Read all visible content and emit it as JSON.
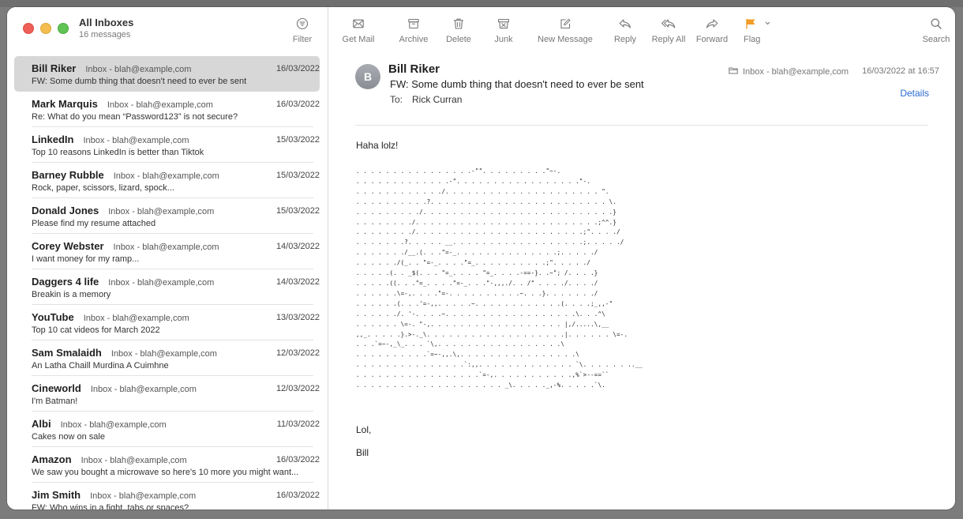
{
  "mailbox": {
    "title": "All Inboxes",
    "subtitle": "16 messages",
    "filter_label": "Filter"
  },
  "toolbar": {
    "get_mail": "Get Mail",
    "archive": "Archive",
    "delete": "Delete",
    "junk": "Junk",
    "new_message": "New Message",
    "reply": "Reply",
    "reply_all": "Reply All",
    "forward": "Forward",
    "flag": "Flag",
    "search": "Search"
  },
  "icons": {
    "get_mail": "envelope-icon",
    "archive": "archive-box-icon",
    "delete": "trash-icon",
    "junk": "junk-bin-icon",
    "new_message": "compose-icon",
    "reply": "reply-arrow-icon",
    "reply_all": "reply-all-arrow-icon",
    "forward": "forward-arrow-icon",
    "flag": "flag-icon",
    "search": "magnifier-icon"
  },
  "colors": {
    "flag": "#f39c28",
    "link": "#2a6cd1",
    "selected_row": "#d7d7d7",
    "traffic_red": "#ee5f57",
    "traffic_yellow": "#f4bd4f",
    "traffic_green": "#5fc454"
  },
  "messages": [
    {
      "sender": "Bill Riker",
      "mailbox": "Inbox - blah@example,com",
      "date": "16/03/2022",
      "subject": "FW: Some dumb thing that doesn't need to ever be sent"
    },
    {
      "sender": "Mark Marquis",
      "mailbox": "Inbox - blah@example,com",
      "date": "16/03/2022",
      "subject": "Re: What do you mean “Password123” is not secure?"
    },
    {
      "sender": "LinkedIn",
      "mailbox": "Inbox - blah@example,com",
      "date": "15/03/2022",
      "subject": "Top 10 reasons LinkedIn is better than Tiktok"
    },
    {
      "sender": "Barney Rubble",
      "mailbox": "Inbox - blah@example,com",
      "date": "15/03/2022",
      "subject": "Rock, paper, scissors, lizard, spock..."
    },
    {
      "sender": "Donald Jones",
      "mailbox": "Inbox - blah@example,com",
      "date": "15/03/2022",
      "subject": "Please find my resume attached"
    },
    {
      "sender": "Corey Webster",
      "mailbox": "Inbox - blah@example,com",
      "date": "14/03/2022",
      "subject": "I want money for my ramp..."
    },
    {
      "sender": "Daggers 4 life",
      "mailbox": "Inbox - blah@example,com",
      "date": "14/03/2022",
      "subject": "Breakin is a memory"
    },
    {
      "sender": "YouTube",
      "mailbox": "Inbox - blah@example,com",
      "date": "13/03/2022",
      "subject": "Top 10 cat videos for March 2022"
    },
    {
      "sender": "Sam Smalaidh",
      "mailbox": "Inbox - blah@example,com",
      "date": "12/03/2022",
      "subject": "An Latha Chaill Murdina A Cuimhne"
    },
    {
      "sender": "Cineworld",
      "mailbox": "Inbox - blah@example,com",
      "date": "12/03/2022",
      "subject": "I'm Batman!"
    },
    {
      "sender": "Albi",
      "mailbox": "Inbox - blah@example,com",
      "date": "11/03/2022",
      "subject": "Cakes now on sale"
    },
    {
      "sender": "Amazon",
      "mailbox": "Inbox - blah@example,com",
      "date": "16/03/2022",
      "subject": "We saw you bought a microwave so here's 10 more you might want..."
    },
    {
      "sender": "Jim Smith",
      "mailbox": "Inbox - blah@example,com",
      "date": "16/03/2022",
      "subject": "FW: Who wins in a fight, tabs or spaces?"
    }
  ],
  "reader": {
    "avatar_initial": "B",
    "from": "Bill Riker",
    "subject": "FW: Some dumb thing that doesn't need to ever be sent",
    "to_label": "To:",
    "to": "Rick Curran",
    "mailbox": "Inbox - blah@example,com",
    "date": "16/03/2022 at 16:57",
    "details_label": "Details",
    "greeting": "Haha lolz!",
    "ascii_art": ". . . . . . . . . . . . . . . .-\"\". . . . . . . . .\"~-.\n. . . . . . . . . . . . .-\". . . . . . . . . . . . . . . . .\"-.\n. . . . . . . . . . . ./. . . . . . . . . . . . . . . . . . . . . \".\n. . . . . . . . . .?. . . . . . . . . . . . . . . . . . . . . . . . \\.\n. . . . . . . . ./. . . . . . . . . . . . . . . . . . . . . . . . . .}\n. . . . . . . ./. . . . . . . . . . . . . . . . . . . . . . . . .;^^.}\n. . . . . . . ./. . . . . . . . . . . . . . . . . . . . . . .;\". . . ./\n. . . . . . .?. . . . . __. . . . . . . . . . . . . . . . . .;. . . . ./\n. . . . . . ./__.(. . .\"=-_. . . . . . . . . . . . . .;. . . . ./\n. . . . . ./(_. . \"=-_. . . .\"=_. . . . . . . . . .;\". . . . ./\n. . . . .(. . _$(. . . \"=_. . . . \"=_. . . .-==-}. .~\"; /. . . .}\n. . . . .((. . .\"=_. . . .\"=-_. . .\"-,,,./. . /\" . . . ./. . . ./\n. . . . . .\\=-,. . . .\"=-. . . . . . . . . .~. . .}. . . . . . ./\n. . . . . .(. . .'=-,,. . . . .~. . . . . . . . . . . .(. . . .;_,,-\"\n. . . . . ./. '-. . . .~. . . . . . . . . . . . . . . . . .\\. . .^\\\n. . . . . . \\=-. \"-,. . . . . . . . . . . . . . . . . . |,/.....\\,__\n,,_. . . . .}.>-._\\. . . . . . . . . . . . . . . . . . .|. . . . . . \\=-.\n. . .`=~-,_\\_. . . `\\,. . . . . . . . . . . . . . . . .\\\n. . . . . . . . . .`=~-,,.\\,. . . . . . . . . . . . . . . .\\\n. . . . . . . . . . . . . . .`:,,. . . . . . . . . . . . . `\\. . . . . . ..__\n. . . . . . . . . . . . . . . . .`=-,. . . . . . . . . . .,%`>--==``\n. . . . . . . . . . . . . . . . . . . . _\\. . . . ._,-%. . . . .`\\.",
    "signoff": "Lol,",
    "signature": "Bill"
  }
}
